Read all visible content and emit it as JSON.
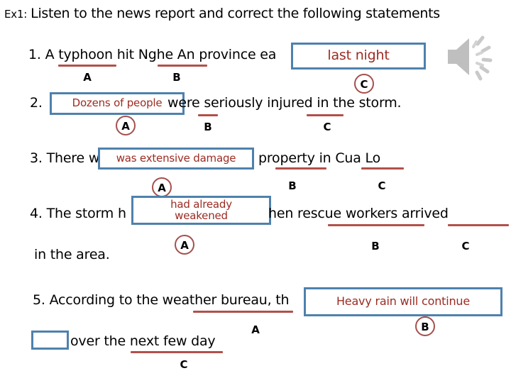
{
  "slide": {
    "background": "#FFFFFF",
    "box_border_color": "#4E81AD",
    "box_text_color": "#9C2B22",
    "underline_color": "#B1504A",
    "circle_color": "#A5504C"
  },
  "header": {
    "exercise_tag": "Ex1:",
    "instruction": "Listen to the news report and correct the following statements"
  },
  "media": {
    "speaker_icon_label": "speaker-icon"
  },
  "questions": [
    {
      "number": "1.",
      "text_before": "1. A typhoon hit Nghe An province ea",
      "answer_box": "last night",
      "box_letter": "C",
      "letters": [
        "A",
        "B"
      ]
    },
    {
      "number": "2.",
      "prefix": "2.",
      "answer_box": "Dozens of people",
      "box_letter": "A",
      "text_after": "were seriously injured in the storm.",
      "letters": [
        "B",
        "C"
      ]
    },
    {
      "number": "3.",
      "text_before": "3. There w",
      "answer_box": "was extensive damage",
      "box_letter": "A",
      "text_after": "property in Cua Lo",
      "letters": [
        "B",
        "C"
      ]
    },
    {
      "number": "4.",
      "text_before": "4. The storm h",
      "answer_box_line1": "had already",
      "answer_box_line2": "weakened",
      "box_letter": "A",
      "text_after": "hen rescue workers arrived",
      "text_wrap": "in the area.",
      "letters": [
        "B",
        "C"
      ]
    },
    {
      "number": "5.",
      "text_before": "5. According to the weather bureau, th",
      "answer_box": "Heavy rain will continue",
      "box_letter": "B",
      "text_after": "over the next few day",
      "empty_box": "",
      "letters": [
        "A",
        "C"
      ]
    }
  ]
}
